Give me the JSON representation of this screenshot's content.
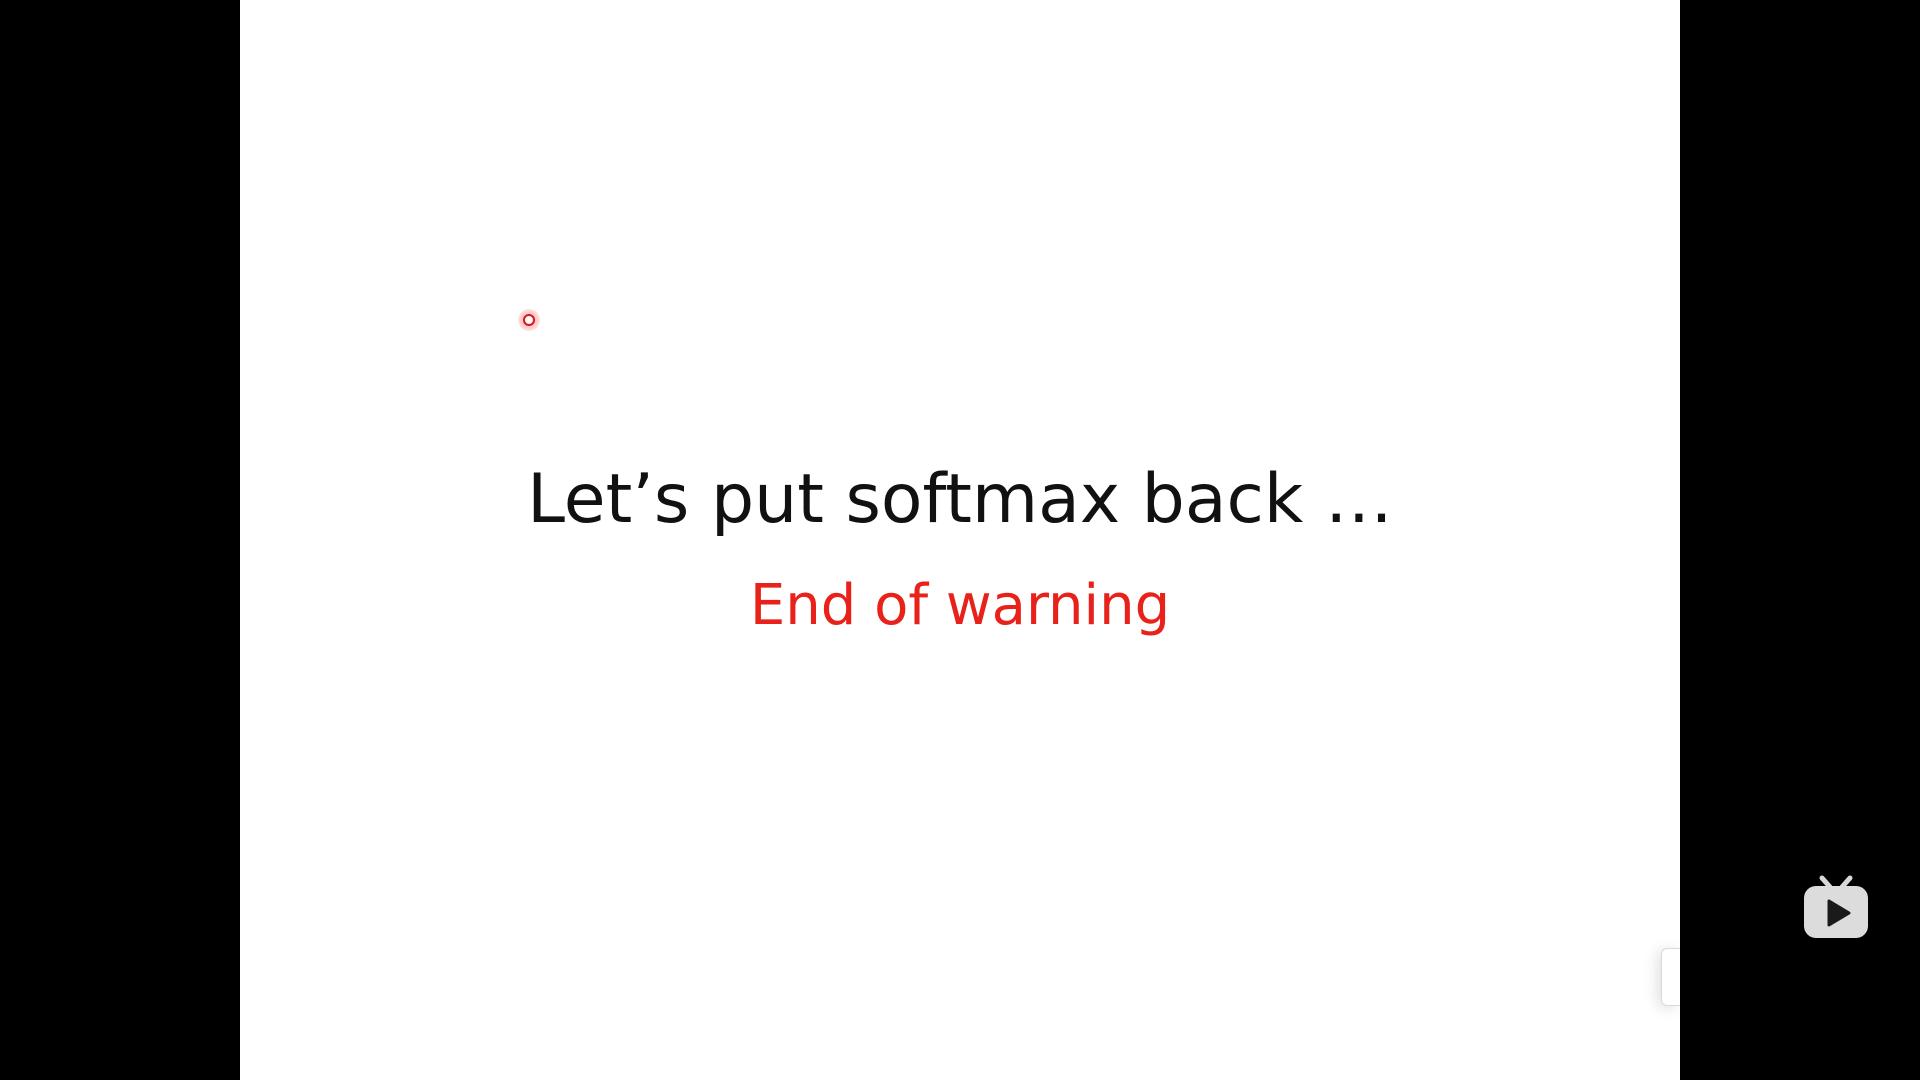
{
  "slide": {
    "title": "Let’s put softmax back …",
    "subtitle": "End of warning",
    "subtitle_color": "#e8211a"
  },
  "icons": {
    "laser": "laser-pointer-icon",
    "player": "video-player-logo-icon"
  }
}
